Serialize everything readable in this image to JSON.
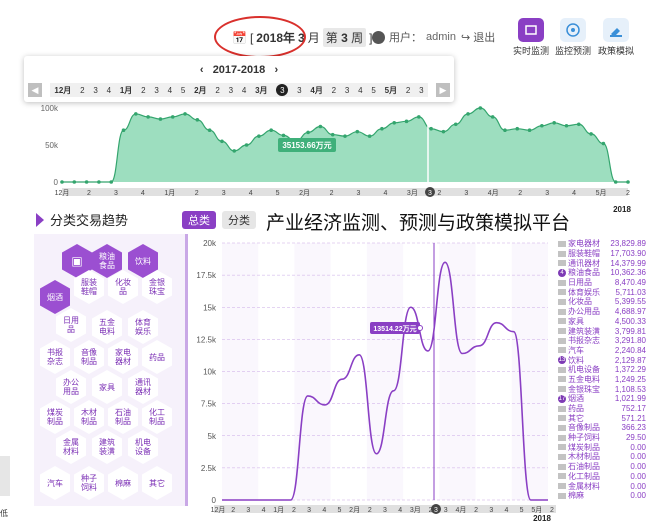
{
  "header": {
    "date": {
      "open": "[",
      "year": "2018年",
      "month": "3",
      "month_unit": "月",
      "week_prefix": "第",
      "week": "3",
      "week_unit": "周",
      "close": "]"
    },
    "user_label": "用户：",
    "username": "admin",
    "logout": "退出",
    "nav": [
      {
        "label": "实时监测",
        "icon": "monitor-icon",
        "color": "#8a3fc4"
      },
      {
        "label": "监控预测",
        "icon": "forecast-icon",
        "color": "#3a8fd8"
      },
      {
        "label": "政策模拟",
        "icon": "policy-icon",
        "color": "#3a8fd8"
      }
    ]
  },
  "popup": {
    "year": "2017-2018",
    "weeks": [
      "12月",
      "2",
      "3",
      "4",
      "1月",
      "2",
      "3",
      "4",
      "5",
      "2月",
      "2",
      "3",
      "4",
      "3月",
      "2",
      "3",
      "4月",
      "2",
      "3",
      "4",
      "5",
      "5月",
      "2",
      "3"
    ],
    "selected_index": 14,
    "selected_label": "3"
  },
  "top_chart": {
    "type": "area",
    "ylabels": [
      "0",
      "50k",
      "100k"
    ],
    "xticks": [
      "12月",
      "2",
      "3",
      "4",
      "1月",
      "2",
      "3",
      "4",
      "5",
      "2月",
      "2",
      "3",
      "4",
      "3月",
      "2",
      "3",
      "4月",
      "2",
      "3",
      "4",
      "5月",
      "2"
    ],
    "tooltip": "35153.66万元",
    "year_tag": "2018",
    "color": "#4cc38a"
  },
  "category": {
    "title": "分类交易趋势",
    "tab_all": "总类",
    "tab_cat": "分类",
    "platform_title": "产业经济监测、预测与政策模拟平台",
    "hexes": [
      {
        "t": "粮油\n食品",
        "on": true
      },
      {
        "t": "饮料",
        "on": true
      },
      {
        "t": "服装\n鞋帽",
        "on": false
      },
      {
        "t": "化妆\n品",
        "on": false
      },
      {
        "t": "金银\n珠宝",
        "on": false
      },
      {
        "t": "烟酒",
        "on": true
      },
      {
        "t": "日用\n品",
        "on": false
      },
      {
        "t": "五金\n电料",
        "on": false
      },
      {
        "t": "体育\n娱乐",
        "on": false
      },
      {
        "t": "书报\n杂志",
        "on": false
      },
      {
        "t": "音像\n制品",
        "on": false
      },
      {
        "t": "家电\n器材",
        "on": false
      },
      {
        "t": "药品",
        "on": false
      },
      {
        "t": "办公\n用品",
        "on": false
      },
      {
        "t": "家具",
        "on": false
      },
      {
        "t": "通讯\n器材",
        "on": false
      },
      {
        "t": "煤炭\n制品",
        "on": false
      },
      {
        "t": "木材\n制品",
        "on": false
      },
      {
        "t": "石油\n制品",
        "on": false
      },
      {
        "t": "化工\n制品",
        "on": false
      },
      {
        "t": "金属\n材料",
        "on": false
      },
      {
        "t": "建筑\n装潢",
        "on": false
      },
      {
        "t": "机电\n设备",
        "on": false
      },
      {
        "t": "汽车",
        "on": false
      },
      {
        "t": "种子\n饲料",
        "on": false
      },
      {
        "t": "棉麻",
        "on": false
      },
      {
        "t": "其它",
        "on": false
      }
    ]
  },
  "chart_data": {
    "type": "line",
    "yticks": [
      "0",
      "2.5k",
      "5k",
      "7.5k",
      "10k",
      "12.5k",
      "15k",
      "17.5k",
      "20k"
    ],
    "ylim": [
      0,
      20000
    ],
    "xticks": [
      "12月",
      "2",
      "3",
      "4",
      "1月",
      "2",
      "3",
      "4",
      "5",
      "2月",
      "2",
      "3",
      "4",
      "3月",
      "2",
      "3",
      "4月",
      "2",
      "3",
      "4",
      "5",
      "5月",
      "2"
    ],
    "tooltip": "13514.22万元",
    "year_tag": "2018",
    "color": "#8a3fc4",
    "values": [
      0,
      0,
      0,
      0,
      0,
      8100,
      7400,
      9400,
      11300,
      3600,
      8500,
      15000,
      11600,
      18500,
      11400,
      12000,
      13800,
      13100,
      0,
      0
    ],
    "legend": [
      {
        "name": "家电器材",
        "value": "23,829.89",
        "hl": false
      },
      {
        "name": "服装鞋帽",
        "value": "17,703.90",
        "hl": false
      },
      {
        "name": "通讯器材",
        "value": "14,379.99",
        "hl": false
      },
      {
        "name": "粮油食品",
        "value": "10,362.36",
        "hl": true,
        "n": "4"
      },
      {
        "name": "日用品",
        "value": "8,470.49",
        "hl": false
      },
      {
        "name": "体育娱乐",
        "value": "5,711.03",
        "hl": false
      },
      {
        "name": "化妆品",
        "value": "5,399.55",
        "hl": false
      },
      {
        "name": "办公用品",
        "value": "4,688.97",
        "hl": false
      },
      {
        "name": "家具",
        "value": "4,500.33",
        "hl": false
      },
      {
        "name": "建筑装潢",
        "value": "3,799.81",
        "hl": false
      },
      {
        "name": "书报杂志",
        "value": "3,291.80",
        "hl": false
      },
      {
        "name": "汽车",
        "value": "2,240.84",
        "hl": false
      },
      {
        "name": "饮料",
        "value": "2,129.87",
        "hl": true,
        "n": "13"
      },
      {
        "name": "机电设备",
        "value": "1,372.29",
        "hl": false
      },
      {
        "name": "五金电料",
        "value": "1,249.25",
        "hl": false
      },
      {
        "name": "金银珠宝",
        "value": "1,108.53",
        "hl": false
      },
      {
        "name": "烟酒",
        "value": "1,021.99",
        "hl": true,
        "n": "17"
      },
      {
        "name": "药品",
        "value": "752.17",
        "hl": false
      },
      {
        "name": "其它",
        "value": "571.21",
        "hl": false
      },
      {
        "name": "音像制品",
        "value": "366.23",
        "hl": false
      },
      {
        "name": "种子饲料",
        "value": "29.50",
        "hl": false
      },
      {
        "name": "煤炭制品",
        "value": "0.00",
        "hl": false
      },
      {
        "name": "木材制品",
        "value": "0.00",
        "hl": false
      },
      {
        "name": "石油制品",
        "value": "0.00",
        "hl": false
      },
      {
        "name": "化工制品",
        "value": "0.00",
        "hl": false
      },
      {
        "name": "金属材料",
        "value": "0.00",
        "hl": false
      },
      {
        "name": "棉麻",
        "value": "0.00",
        "hl": false
      }
    ]
  },
  "edge_label": "低"
}
